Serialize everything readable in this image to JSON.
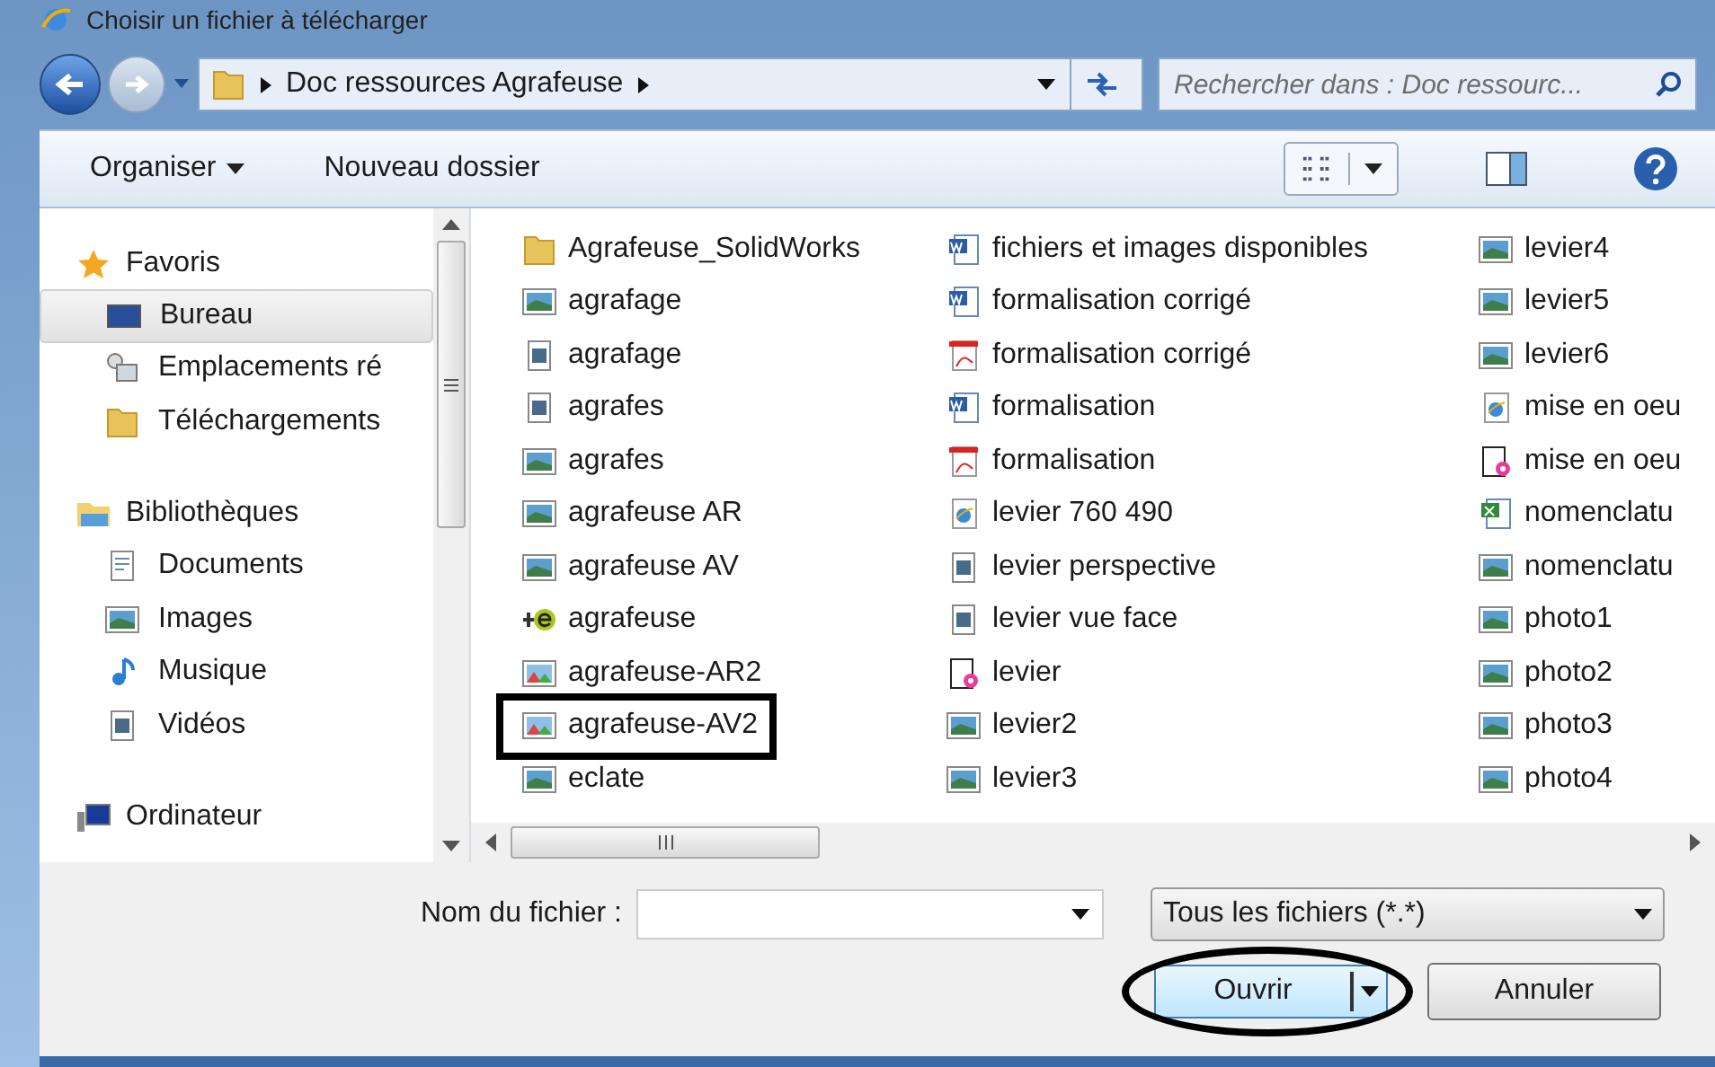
{
  "window": {
    "title": "Choisir un fichier à télécharger"
  },
  "address": {
    "path": "Doc ressources Agrafeuse"
  },
  "search": {
    "placeholder": "Rechercher dans : Doc ressourc..."
  },
  "toolbar": {
    "items": [
      {
        "label": "Organiser",
        "kind": "menu"
      },
      {
        "label": "Nouveau dossier",
        "kind": "button"
      }
    ]
  },
  "nav": {
    "groups": [
      {
        "label": "Favoris",
        "kind": "star",
        "selected": false,
        "children": [
          {
            "label": "Bureau",
            "kind": "desktop",
            "selected": true
          },
          {
            "label": "Emplacements ré",
            "kind": "recent",
            "selected": false
          },
          {
            "label": "Téléchargements",
            "kind": "folder",
            "selected": false
          }
        ]
      },
      {
        "label": "Bibliothèques",
        "kind": "library",
        "selected": false,
        "children": [
          {
            "label": "Documents",
            "kind": "document",
            "selected": false
          },
          {
            "label": "Images",
            "kind": "image",
            "selected": false
          },
          {
            "label": "Musique",
            "kind": "music",
            "selected": false
          },
          {
            "label": "Vidéos",
            "kind": "video",
            "selected": false
          }
        ]
      },
      {
        "label": "Ordinateur",
        "kind": "computer",
        "selected": false
      }
    ]
  },
  "files": [
    {
      "name": "Agrafeuse_SolidWorks",
      "kind": "folder",
      "annotated": false
    },
    {
      "name": "agrafage",
      "kind": "image",
      "annotated": false
    },
    {
      "name": "agrafage",
      "kind": "video",
      "annotated": false
    },
    {
      "name": "agrafes",
      "kind": "video",
      "annotated": false
    },
    {
      "name": "agrafes",
      "kind": "image",
      "annotated": false
    },
    {
      "name": "agrafeuse AR",
      "kind": "image",
      "annotated": false
    },
    {
      "name": "agrafeuse AV",
      "kind": "image",
      "annotated": false
    },
    {
      "name": "agrafeuse",
      "kind": "edrawing",
      "annotated": false
    },
    {
      "name": "agrafeuse-AR2",
      "kind": "picture",
      "annotated": false
    },
    {
      "name": "agrafeuse-AV2",
      "kind": "picture",
      "annotated": true
    },
    {
      "name": "eclate",
      "kind": "image",
      "annotated": false
    },
    {
      "name": "fichiers et images disponibles",
      "kind": "word",
      "annotated": false
    },
    {
      "name": "formalisation corrigé",
      "kind": "word",
      "annotated": false
    },
    {
      "name": "formalisation corrigé",
      "kind": "pdf",
      "annotated": false
    },
    {
      "name": "formalisation",
      "kind": "word",
      "annotated": false
    },
    {
      "name": "formalisation",
      "kind": "pdf",
      "annotated": false
    },
    {
      "name": "levier 760 490",
      "kind": "web",
      "annotated": false
    },
    {
      "name": "levier perspective",
      "kind": "video",
      "annotated": false
    },
    {
      "name": "levier vue face",
      "kind": "video",
      "annotated": false
    },
    {
      "name": "levier",
      "kind": "sketch",
      "annotated": false
    },
    {
      "name": "levier2",
      "kind": "image",
      "annotated": false
    },
    {
      "name": "levier3",
      "kind": "image",
      "annotated": false
    },
    {
      "name": "levier4",
      "kind": "image",
      "annotated": false
    },
    {
      "name": "levier5",
      "kind": "image",
      "annotated": false
    },
    {
      "name": "levier6",
      "kind": "image",
      "annotated": false
    },
    {
      "name": "mise en oeu",
      "kind": "web",
      "annotated": false
    },
    {
      "name": "mise en oeu",
      "kind": "sketch",
      "annotated": false
    },
    {
      "name": "nomenclatu",
      "kind": "excel",
      "annotated": false
    },
    {
      "name": "nomenclatu",
      "kind": "image",
      "annotated": false
    },
    {
      "name": "photo1",
      "kind": "image",
      "annotated": false
    },
    {
      "name": "photo2",
      "kind": "image",
      "annotated": false
    },
    {
      "name": "photo3",
      "kind": "image",
      "annotated": false
    },
    {
      "name": "photo4",
      "kind": "image",
      "annotated": false
    }
  ],
  "footer": {
    "filename_label": "Nom du fichier :",
    "filter": "Tous les fichiers (*.*)",
    "buttons": [
      {
        "label": "Ouvrir",
        "kind": "split",
        "annotated": true
      },
      {
        "label": "Annuler",
        "kind": "plain",
        "annotated": false
      }
    ]
  }
}
